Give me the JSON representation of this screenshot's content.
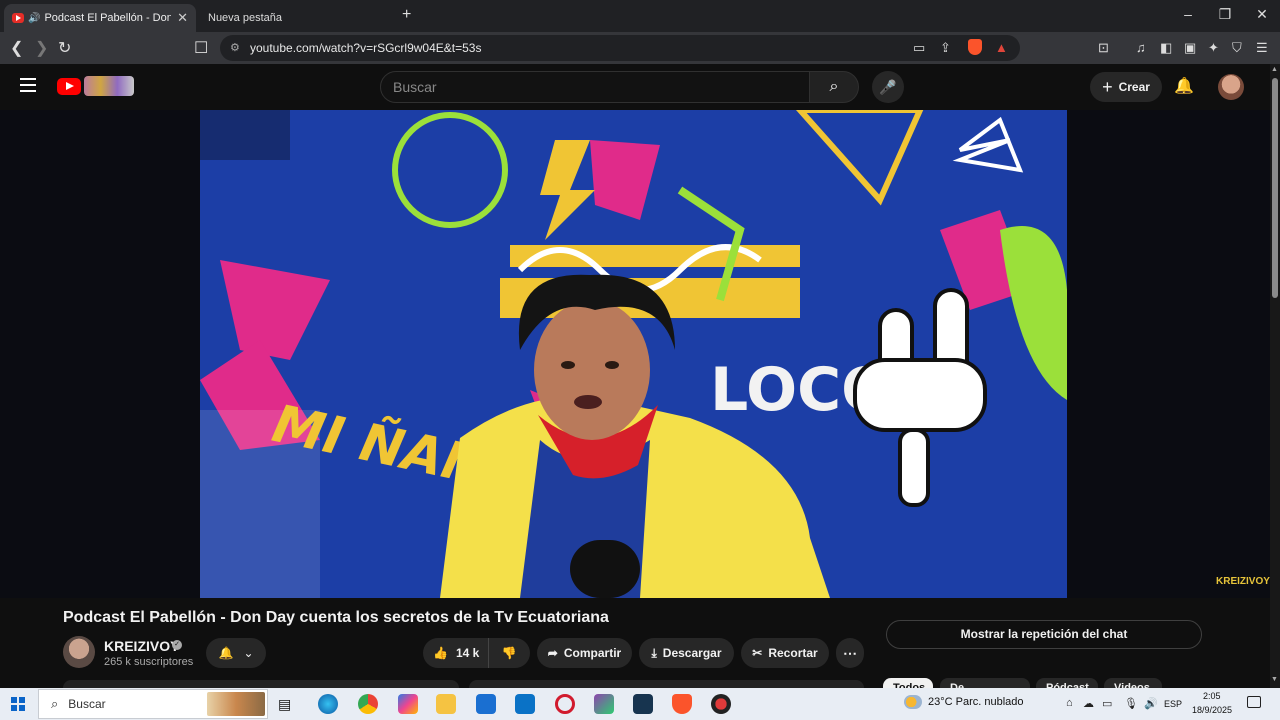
{
  "browser": {
    "active_tab_title": "Podcast El Pabellón - Don Day",
    "new_tab_title": "Nueva pestaña",
    "url": "youtube.com/watch?v=rSGcrl9w04E&t=53s"
  },
  "youtube": {
    "search_placeholder": "Buscar",
    "create_label": "Crear"
  },
  "video": {
    "title": "Podcast El Pabellón - Don Day cuenta los secretos de la Tv Ecuatoriana",
    "watermark": "KREIZIVOY",
    "wall_text_1": "MI ÑAÑO",
    "wall_text_2": "LOCO"
  },
  "channel": {
    "name": "KREIZIVOY",
    "subscribers": "265 k suscriptores"
  },
  "actions": {
    "likes": "14 k",
    "share": "Compartir",
    "download": "Descargar",
    "clip": "Recortar",
    "chat_replay": "Mostrar la repetición del chat"
  },
  "chips": [
    "Todos",
    "De KREIZIVOY",
    "Pódcast",
    "Videos"
  ],
  "taskbar": {
    "search_label": "Buscar",
    "weather": "23°C  Parc. nublado",
    "language": "ESP",
    "time": "2:05",
    "date": "18/9/2025"
  },
  "colors": {
    "youtube_red": "#ff0000",
    "page_bg": "#0f0f0f",
    "wall_blue": "#1c3ea6",
    "shirt_yellow": "#f4e04a",
    "bandana_red": "#d6202a"
  }
}
